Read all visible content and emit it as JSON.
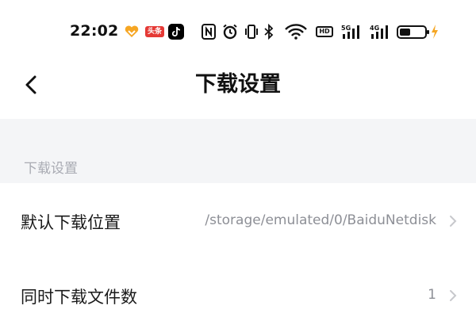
{
  "status_bar": {
    "time": "22:02",
    "icons": [
      "heart-app-icon",
      "news-app-icon",
      "tiktok-app-icon",
      "nfc-icon",
      "alarm-icon",
      "vibrate-icon",
      "bluetooth-icon",
      "wifi-icon",
      "hd-icon",
      "signal-5g-icon",
      "signal-4g-icon",
      "battery-icon"
    ],
    "news_label": "头条",
    "hd_label": "HD",
    "sig5g_label": "5G",
    "sig4g_label": "4G",
    "accent_heart": "#f6a623",
    "accent_battery_charge": "#f5a623"
  },
  "title_bar": {
    "title": "下载设置"
  },
  "section": {
    "header": "下载设置"
  },
  "rows": [
    {
      "label": "默认下载位置",
      "value": "/storage/emulated/0/BaiduNetdisk"
    },
    {
      "label": "同时下载文件数",
      "value": "1"
    }
  ],
  "colors": {
    "background": "#ffffff",
    "band": "#f4f5f7",
    "section_text": "#a9abb3",
    "value_text": "#8d8f96"
  }
}
